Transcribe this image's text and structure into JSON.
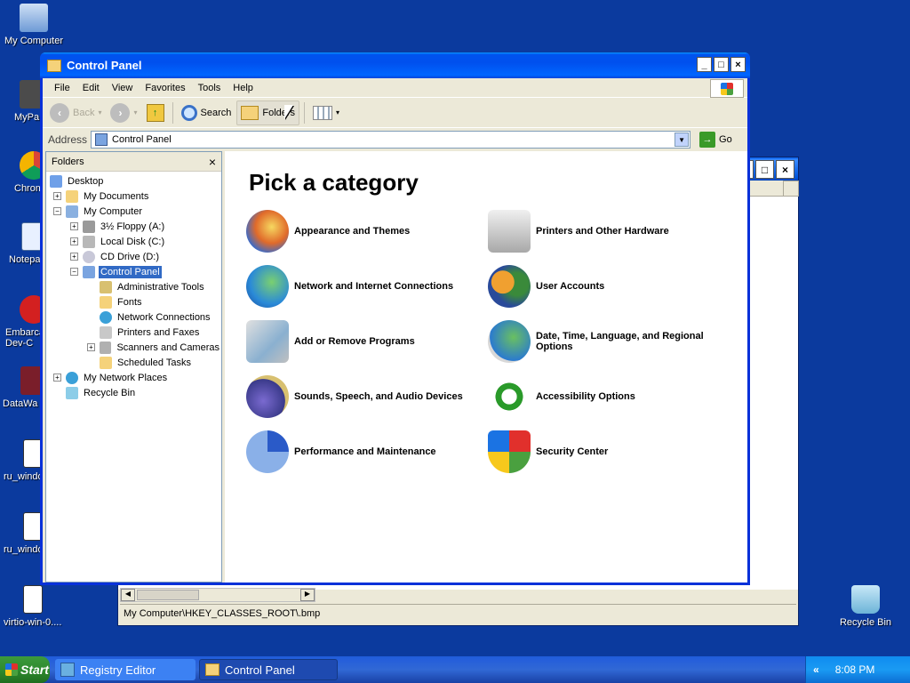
{
  "desktop": {
    "icons": [
      {
        "label": "My Computer"
      },
      {
        "label": "MyPa"
      },
      {
        "label": "Chrom"
      },
      {
        "label": "Notepa"
      },
      {
        "label": "Embarca\nDev-C"
      },
      {
        "label": "DataWa"
      },
      {
        "label": "ru_windo"
      },
      {
        "label": "ru_windo"
      },
      {
        "label": "virtio-win-0...."
      },
      {
        "label": "Recycle Bin"
      }
    ]
  },
  "registry_window": {
    "status_text": "My Computer\\HKEY_CLASSES_ROOT\\.bmp"
  },
  "control_panel": {
    "title": "Control Panel",
    "menu": [
      "File",
      "Edit",
      "View",
      "Favorites",
      "Tools",
      "Help"
    ],
    "toolbar": {
      "back": "Back",
      "search": "Search",
      "folders": "Folders"
    },
    "address": {
      "label": "Address",
      "value": "Control Panel",
      "go": "Go"
    },
    "folders_pane": {
      "title": "Folders",
      "tree": [
        {
          "label": "Desktop"
        },
        {
          "label": "My Documents"
        },
        {
          "label": "My Computer"
        },
        {
          "label": "3½ Floppy (A:)"
        },
        {
          "label": "Local Disk (C:)"
        },
        {
          "label": "CD Drive (D:)"
        },
        {
          "label": "Control Panel"
        },
        {
          "label": "Administrative Tools"
        },
        {
          "label": "Fonts"
        },
        {
          "label": "Network Connections"
        },
        {
          "label": "Printers and Faxes"
        },
        {
          "label": "Scanners and Cameras"
        },
        {
          "label": "Scheduled Tasks"
        },
        {
          "label": "My Network Places"
        },
        {
          "label": "Recycle Bin"
        }
      ]
    },
    "heading": "Pick a category",
    "categories": [
      {
        "label": "Appearance and Themes"
      },
      {
        "label": "Printers and Other Hardware"
      },
      {
        "label": "Network and Internet Connections"
      },
      {
        "label": "User Accounts"
      },
      {
        "label": "Add or Remove Programs"
      },
      {
        "label": "Date, Time, Language, and Regional Options"
      },
      {
        "label": "Sounds, Speech, and Audio Devices"
      },
      {
        "label": "Accessibility Options"
      },
      {
        "label": "Performance and Maintenance"
      },
      {
        "label": "Security Center"
      }
    ]
  },
  "taskbar": {
    "start": "Start",
    "items": [
      {
        "label": "Registry Editor"
      },
      {
        "label": "Control Panel"
      }
    ],
    "tray_chevron": "«",
    "clock": "8:08 PM"
  }
}
